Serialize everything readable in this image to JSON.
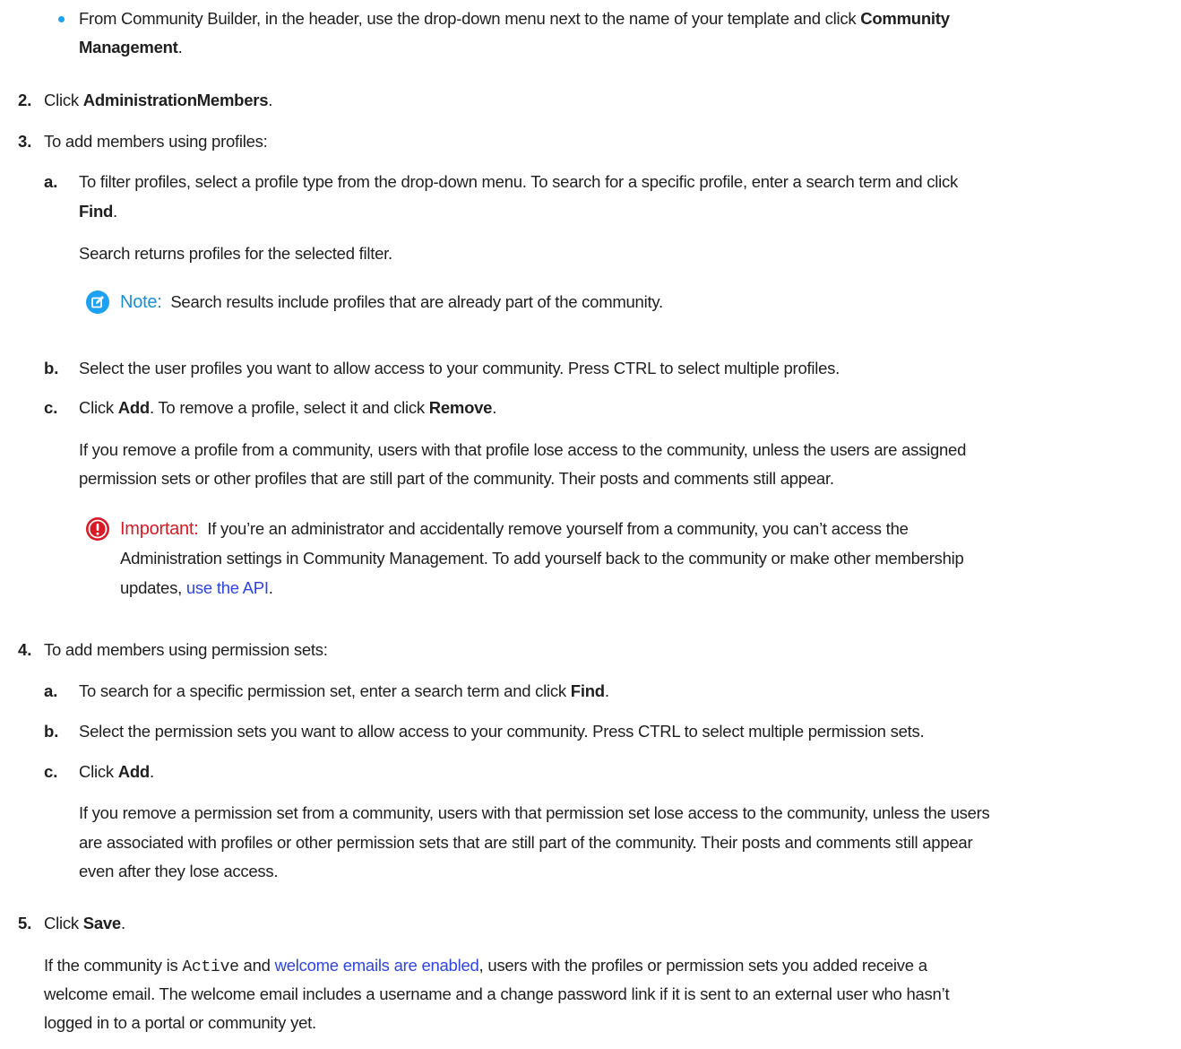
{
  "bullet_item": {
    "line1_before": "From Community Builder, in the header, use the drop-down menu next to the name of your template and click ",
    "line1_bold": "Community",
    "line2_bold": "Management",
    "line2_after": "."
  },
  "step2": {
    "number": "2.",
    "before": "Click ",
    "bold": "AdministrationMembers",
    "after": "."
  },
  "step3": {
    "number": "3.",
    "text": "To add members using profiles:",
    "a": {
      "letter": "a.",
      "line1": "To filter profiles, select a profile type from the drop-down menu. To search for a specific profile, enter a search term and click",
      "line2_bold": "Find",
      "line2_after": ".",
      "result_text": "Search returns profiles for the selected filter.",
      "note_label": "Note:",
      "note_text": "Search results include profiles that are already part of the community."
    },
    "b": {
      "letter": "b.",
      "text": "Select the user profiles you want to allow access to your community. Press CTRL to select multiple profiles."
    },
    "c": {
      "letter": "c.",
      "before": "Click ",
      "bold1": "Add",
      "middle": ". To remove a profile, select it and click ",
      "bold2": "Remove",
      "after": ".",
      "para_line1": "If you remove a profile from a community, users with that profile lose access to the community, unless the users are assigned",
      "para_line2": "permission sets or other profiles that are still part of the community. Their posts and comments still appear.",
      "important_label": "Important:",
      "important_line1": "If you’re an administrator and accidentally remove yourself from a community, you can’t access the",
      "important_line2": "Administration settings in Community Management. To add yourself back to the community or make other membership",
      "important_line3_before": "updates, ",
      "important_link": "use the API",
      "important_line3_after": "."
    }
  },
  "step4": {
    "number": "4.",
    "text": "To add members using permission sets:",
    "a": {
      "letter": "a.",
      "before": "To search for a specific permission set, enter a search term and click ",
      "bold": "Find",
      "after": "."
    },
    "b": {
      "letter": "b.",
      "text": "Select the permission sets you want to allow access to your community. Press CTRL to select multiple permission sets."
    },
    "c": {
      "letter": "c.",
      "before": "Click ",
      "bold": "Add",
      "after": ".",
      "para_line1": "If you remove a permission set from a community, users with that permission set lose access to the community, unless the users",
      "para_line2": "are associated with profiles or other permission sets that are still part of the community. Their posts and comments still appear",
      "para_line3": "even after they lose access."
    }
  },
  "step5": {
    "number": "5.",
    "before": "Click ",
    "bold": "Save",
    "after": ".",
    "para_line1_a": "If the community is ",
    "para_line1_code": "Active",
    "para_line1_b": " and ",
    "para_line1_link": "welcome emails are enabled",
    "para_line1_c": ", users with the profiles or permission sets you added receive a",
    "para_line2": "welcome email. The welcome email includes a username and a change password link if it is sent to an external user who hasn’t",
    "para_line3": "logged in to a portal or community yet."
  },
  "colors": {
    "bullet": "#1da1f2",
    "link": "#2e45e3",
    "note": "#1a8fd4",
    "important": "#d81a24"
  },
  "icons": {
    "note": "pencil-edit-icon",
    "important": "exclamation-icon"
  }
}
